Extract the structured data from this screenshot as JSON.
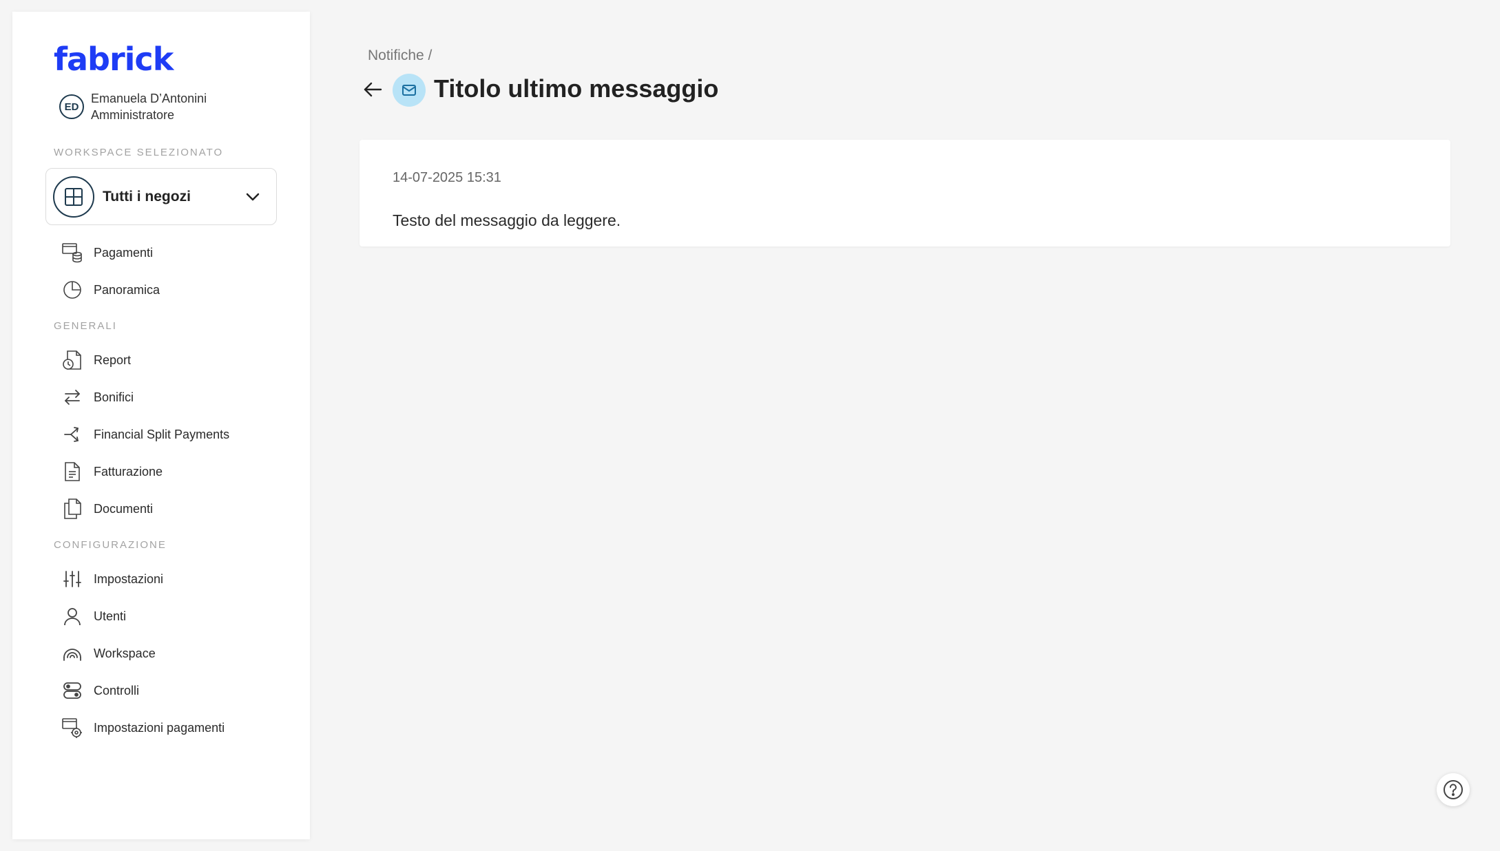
{
  "app": {
    "logo_text": "fabrick",
    "brand_color": "#1e3cf5"
  },
  "user": {
    "initials": "ED",
    "name": "Emanuela D’Antonini",
    "role": "Amministratore"
  },
  "sidebar": {
    "workspace_section": "WORKSPACE SELEZIONATO",
    "workspace_selected": "Tutti i negozi",
    "items_top": [
      {
        "label": "Pagamenti",
        "icon": "payments-icon"
      },
      {
        "label": "Panoramica",
        "icon": "pie-chart-icon"
      }
    ],
    "general_section": "GENERALI",
    "items_general": [
      {
        "label": "Report",
        "icon": "report-icon"
      },
      {
        "label": "Bonifici",
        "icon": "transfer-arrows-icon"
      },
      {
        "label": "Financial Split Payments",
        "icon": "split-icon"
      },
      {
        "label": "Fatturazione",
        "icon": "invoice-icon"
      },
      {
        "label": "Documenti",
        "icon": "documents-icon"
      }
    ],
    "config_section": "CONFIGURAZIONE",
    "items_config": [
      {
        "label": "Impostazioni",
        "icon": "sliders-icon"
      },
      {
        "label": "Utenti",
        "icon": "user-icon"
      },
      {
        "label": "Workspace",
        "icon": "workspace-icon"
      },
      {
        "label": "Controlli",
        "icon": "controls-icon"
      },
      {
        "label": "Impostazioni pagamenti",
        "icon": "payment-settings-icon"
      }
    ]
  },
  "main": {
    "breadcrumb": "Notifiche /",
    "title": "Titolo ultimo messaggio",
    "message": {
      "date": "14-07-2025 15:31",
      "text": "Testo del messaggio da leggere."
    }
  }
}
